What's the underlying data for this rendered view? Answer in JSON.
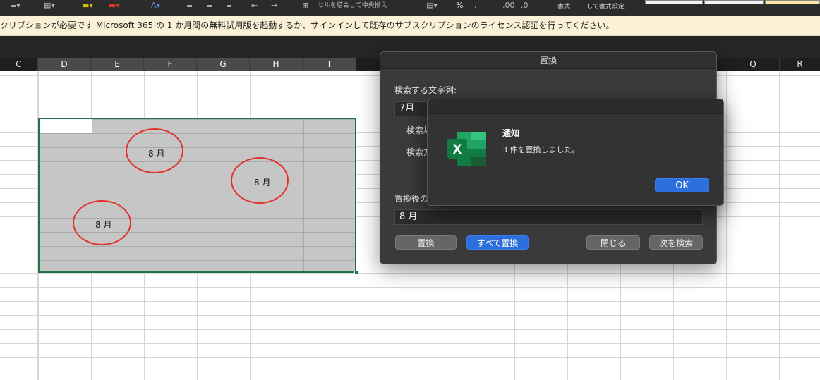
{
  "ribbon": {
    "format_label": "書式",
    "format_setting_label": "して書式設定",
    "merge_center_label": "セルを結合して中央揃え",
    "percent_symbol": "%"
  },
  "message_bar": {
    "text": "クリプションが必要です  Microsoft 365 の 1 か月間の無料試用版を起動するか、サインインして既存のサブスクリプションのライセンス認証を行ってください。"
  },
  "columns": [
    "C",
    "D",
    "E",
    "F",
    "G",
    "H",
    "I",
    "Q",
    "R"
  ],
  "cells": [
    {
      "id": "F9",
      "value": "8 月"
    },
    {
      "id": "H11",
      "value": "8 月"
    },
    {
      "id": "E14",
      "value": "8 月"
    }
  ],
  "replace_dialog": {
    "title": "置換",
    "search_label": "検索する文字列:",
    "search_value": "7月",
    "scope_label": "検索場",
    "direction_label": "検索方",
    "replace_label": "置換後の",
    "replace_value": "8 月",
    "buttons": {
      "replace": "置換",
      "replace_all": "すべて置換",
      "close": "閉じる",
      "find_next": "次を検索"
    }
  },
  "alert": {
    "title": "通知",
    "message": "3 件を置換しました。",
    "ok_label": "OK",
    "icon": "excel-app-icon"
  },
  "colors": {
    "selection_border": "#227447",
    "highlight_ring": "#e2332a",
    "primary_button": "#2d6fdc",
    "message_bar_bg": "#fbf1d7"
  }
}
